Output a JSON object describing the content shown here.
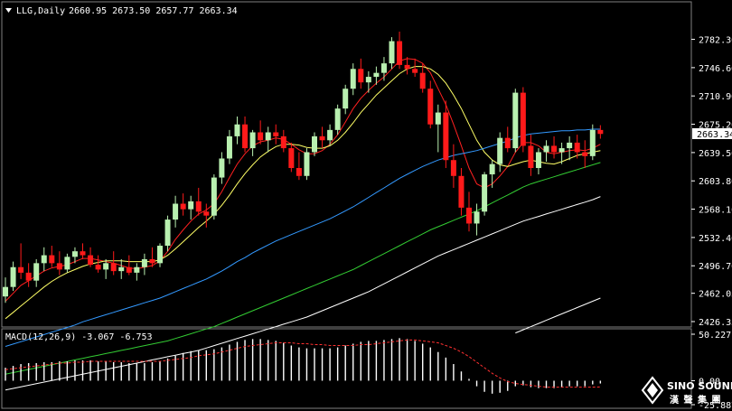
{
  "header": {
    "symbol_label": "LLG,Daily",
    "ohlc": "2660.95 2673.50 2657.77 2663.34"
  },
  "macd_label": "MACD(12,26,9) -3.067 -6.753",
  "watermark": {
    "line1": "SINO SOUND",
    "line2": "漢 聲 集 團"
  },
  "colors": {
    "background": "#000000",
    "bull": "#b9f0b0",
    "bear": "#ff1a1a",
    "ma_fast": "#ff2020",
    "ma_mid": "#ffff66",
    "ma_blue": "#3399ff",
    "ma_green": "#33cc33",
    "ma_white": "#ffffff",
    "macd_hist": "#ffffff",
    "macd_signal": "#ff3030"
  },
  "chart_data": [
    {
      "type": "candlestick",
      "title": "LLG,Daily",
      "ylim": [
        2426.35,
        2800
      ],
      "y_ticks": [
        "2782.30",
        "2746.60",
        "2710.90",
        "2675.20",
        "2639.50",
        "2603.80",
        "2568.10",
        "2532.40",
        "2496.70",
        "2462.05",
        "2426.35"
      ],
      "current_price": "2663.34",
      "candles": [
        [
          2458,
          2482,
          2450,
          2470
        ],
        [
          2470,
          2502,
          2465,
          2495
        ],
        [
          2495,
          2525,
          2480,
          2488
        ],
        [
          2488,
          2500,
          2470,
          2478
        ],
        [
          2478,
          2505,
          2470,
          2500
        ],
        [
          2500,
          2520,
          2490,
          2510
        ],
        [
          2510,
          2522,
          2495,
          2500
        ],
        [
          2500,
          2515,
          2485,
          2492
        ],
        [
          2492,
          2512,
          2488,
          2508
        ],
        [
          2508,
          2520,
          2500,
          2515
        ],
        [
          2515,
          2525,
          2505,
          2510
        ],
        [
          2510,
          2520,
          2495,
          2498
        ],
        [
          2498,
          2510,
          2488,
          2492
        ],
        [
          2492,
          2505,
          2480,
          2500
        ],
        [
          2500,
          2515,
          2485,
          2490
        ],
        [
          2490,
          2505,
          2480,
          2495
        ],
        [
          2495,
          2510,
          2485,
          2488
        ],
        [
          2488,
          2500,
          2478,
          2495
        ],
        [
          2495,
          2512,
          2485,
          2505
        ],
        [
          2505,
          2520,
          2495,
          2500
        ],
        [
          2500,
          2525,
          2495,
          2522
        ],
        [
          2522,
          2560,
          2515,
          2555
        ],
        [
          2555,
          2585,
          2545,
          2575
        ],
        [
          2575,
          2588,
          2560,
          2568
        ],
        [
          2568,
          2585,
          2555,
          2578
        ],
        [
          2578,
          2595,
          2560,
          2565
        ],
        [
          2565,
          2575,
          2545,
          2560
        ],
        [
          2560,
          2612,
          2555,
          2608
        ],
        [
          2608,
          2640,
          2600,
          2632
        ],
        [
          2632,
          2668,
          2625,
          2660
        ],
        [
          2660,
          2685,
          2650,
          2675
        ],
        [
          2675,
          2685,
          2640,
          2645
        ],
        [
          2645,
          2668,
          2635,
          2665
        ],
        [
          2665,
          2680,
          2650,
          2655
        ],
        [
          2655,
          2672,
          2640,
          2665
        ],
        [
          2665,
          2675,
          2650,
          2660
        ],
        [
          2660,
          2668,
          2640,
          2645
        ],
        [
          2645,
          2652,
          2615,
          2620
        ],
        [
          2620,
          2640,
          2605,
          2610
        ],
        [
          2610,
          2645,
          2605,
          2640
        ],
        [
          2640,
          2665,
          2635,
          2660
        ],
        [
          2660,
          2672,
          2645,
          2655
        ],
        [
          2655,
          2675,
          2648,
          2668
        ],
        [
          2668,
          2700,
          2662,
          2695
        ],
        [
          2695,
          2725,
          2688,
          2720
        ],
        [
          2720,
          2752,
          2712,
          2745
        ],
        [
          2745,
          2758,
          2720,
          2728
        ],
        [
          2728,
          2742,
          2715,
          2735
        ],
        [
          2735,
          2748,
          2725,
          2740
        ],
        [
          2740,
          2760,
          2730,
          2752
        ],
        [
          2752,
          2785,
          2745,
          2780
        ],
        [
          2780,
          2792,
          2745,
          2750
        ],
        [
          2750,
          2760,
          2738,
          2745
        ],
        [
          2745,
          2758,
          2735,
          2740
        ],
        [
          2740,
          2752,
          2715,
          2720
        ],
        [
          2720,
          2730,
          2670,
          2675
        ],
        [
          2675,
          2700,
          2640,
          2690
        ],
        [
          2690,
          2705,
          2620,
          2630
        ],
        [
          2630,
          2650,
          2595,
          2610
        ],
        [
          2610,
          2620,
          2560,
          2570
        ],
        [
          2570,
          2590,
          2540,
          2550
        ],
        [
          2550,
          2575,
          2535,
          2565
        ],
        [
          2565,
          2615,
          2560,
          2612
        ],
        [
          2612,
          2630,
          2595,
          2625
        ],
        [
          2625,
          2665,
          2615,
          2658
        ],
        [
          2658,
          2672,
          2640,
          2645
        ],
        [
          2645,
          2720,
          2640,
          2715
        ],
        [
          2715,
          2722,
          2640,
          2648
        ],
        [
          2648,
          2662,
          2610,
          2620
        ],
        [
          2620,
          2645,
          2612,
          2640
        ],
        [
          2640,
          2655,
          2628,
          2648
        ],
        [
          2648,
          2660,
          2632,
          2640
        ],
        [
          2640,
          2652,
          2625,
          2645
        ],
        [
          2645,
          2660,
          2630,
          2652
        ],
        [
          2652,
          2662,
          2632,
          2640
        ],
        [
          2640,
          2655,
          2620,
          2635
        ],
        [
          2635,
          2675,
          2630,
          2668
        ],
        [
          2668,
          2674,
          2657,
          2663
        ]
      ],
      "moving_averages": [
        {
          "key": "ma_fast",
          "values": [
            2452,
            2462,
            2472,
            2478,
            2484,
            2490,
            2494,
            2496,
            2498,
            2502,
            2506,
            2506,
            2504,
            2502,
            2500,
            2497,
            2494,
            2493,
            2495,
            2497,
            2503,
            2515,
            2530,
            2542,
            2553,
            2562,
            2567,
            2575,
            2590,
            2608,
            2625,
            2638,
            2648,
            2653,
            2655,
            2658,
            2656,
            2650,
            2643,
            2638,
            2638,
            2642,
            2650,
            2662,
            2678,
            2695,
            2708,
            2718,
            2727,
            2735,
            2745,
            2755,
            2758,
            2757,
            2752,
            2740,
            2720,
            2700,
            2675,
            2648,
            2620,
            2600,
            2595,
            2600,
            2610,
            2622,
            2640,
            2652,
            2652,
            2648,
            2640,
            2638,
            2640,
            2642,
            2643,
            2642,
            2645,
            2650
          ]
        },
        {
          "key": "ma_mid",
          "values": [
            2430,
            2438,
            2446,
            2454,
            2462,
            2470,
            2477,
            2483,
            2488,
            2492,
            2496,
            2499,
            2501,
            2503,
            2503,
            2503,
            2502,
            2502,
            2502,
            2502,
            2504,
            2510,
            2518,
            2527,
            2536,
            2545,
            2553,
            2562,
            2573,
            2586,
            2600,
            2613,
            2624,
            2634,
            2641,
            2647,
            2650,
            2650,
            2649,
            2646,
            2645,
            2645,
            2648,
            2655,
            2665,
            2677,
            2690,
            2701,
            2712,
            2721,
            2730,
            2739,
            2745,
            2748,
            2748,
            2745,
            2738,
            2727,
            2712,
            2695,
            2675,
            2655,
            2640,
            2630,
            2624,
            2622,
            2625,
            2628,
            2630,
            2628,
            2626,
            2625,
            2628,
            2632,
            2636,
            2638,
            2640,
            2642
          ]
        },
        {
          "key": "ma_blue",
          "values": [
            2395,
            2398,
            2401,
            2404,
            2407,
            2410,
            2413,
            2416,
            2419,
            2422,
            2426,
            2429,
            2432,
            2435,
            2438,
            2441,
            2444,
            2447,
            2450,
            2453,
            2456,
            2460,
            2464,
            2468,
            2472,
            2476,
            2480,
            2485,
            2490,
            2496,
            2502,
            2507,
            2513,
            2518,
            2523,
            2528,
            2532,
            2536,
            2540,
            2544,
            2548,
            2552,
            2556,
            2561,
            2566,
            2571,
            2577,
            2583,
            2589,
            2595,
            2601,
            2607,
            2612,
            2617,
            2622,
            2626,
            2630,
            2633,
            2636,
            2638,
            2640,
            2642,
            2645,
            2648,
            2651,
            2654,
            2658,
            2661,
            2663,
            2664,
            2665,
            2666,
            2667,
            2667,
            2668,
            2668,
            2669,
            2669
          ]
        },
        {
          "key": "ma_green",
          "values": [
            2360,
            2362,
            2364,
            2366,
            2368,
            2370,
            2372,
            2374,
            2376,
            2378,
            2380,
            2382,
            2384,
            2386,
            2388,
            2390,
            2392,
            2394,
            2396,
            2398,
            2400,
            2402,
            2405,
            2408,
            2411,
            2414,
            2417,
            2420,
            2424,
            2428,
            2432,
            2436,
            2440,
            2444,
            2448,
            2452,
            2456,
            2460,
            2464,
            2468,
            2472,
            2476,
            2480,
            2484,
            2488,
            2492,
            2497,
            2502,
            2507,
            2512,
            2517,
            2522,
            2527,
            2532,
            2537,
            2542,
            2546,
            2550,
            2554,
            2558,
            2562,
            2566,
            2571,
            2576,
            2581,
            2586,
            2591,
            2596,
            2600,
            2603,
            2606,
            2609,
            2612,
            2615,
            2618,
            2621,
            2624,
            2627
          ]
        },
        {
          "key": "ma_white",
          "values": [
            2340,
            2342,
            2344,
            2346,
            2348,
            2350,
            2352,
            2354,
            2356,
            2358,
            2360,
            2362,
            2364,
            2366,
            2368,
            2370,
            2372,
            2374,
            2376,
            2378,
            2380,
            2382,
            2384,
            2386,
            2388,
            2390,
            2393,
            2396,
            2399,
            2402,
            2405,
            2408,
            2411,
            2414,
            2417,
            2420,
            2423,
            2426,
            2429,
            2432,
            2436,
            2440,
            2444,
            2448,
            2452,
            2456,
            2460,
            2464,
            2469,
            2474,
            2479,
            2484,
            2489,
            2494,
            2499,
            2504,
            2509,
            2513,
            2517,
            2521,
            2525,
            2529,
            2533,
            2537,
            2541,
            2545,
            2549,
            2553,
            2556,
            2559,
            2562,
            2565,
            2568,
            2571,
            2574,
            2577,
            2580,
            2584
          ]
        },
        {
          "key": "ma_white",
          "values": [
            null,
            null,
            null,
            null,
            null,
            null,
            null,
            null,
            null,
            null,
            null,
            null,
            null,
            null,
            null,
            null,
            null,
            null,
            null,
            null,
            null,
            null,
            null,
            null,
            null,
            null,
            null,
            null,
            null,
            null,
            null,
            null,
            null,
            null,
            null,
            null,
            null,
            null,
            null,
            null,
            null,
            null,
            null,
            null,
            null,
            null,
            null,
            null,
            null,
            null,
            null,
            null,
            null,
            null,
            null,
            null,
            null,
            null,
            null,
            null,
            null,
            null,
            null,
            null,
            null,
            null,
            2412,
            2416,
            2420,
            2424,
            2428,
            2432,
            2436,
            2440,
            2444,
            2448,
            2452,
            2456
          ]
        }
      ]
    },
    {
      "type": "bar",
      "title": "MACD(12,26,9) -3.067 -6.753",
      "ylim": [
        -25.887,
        50.227
      ],
      "y_ticks": [
        "50.227",
        "0.00",
        "-25.887"
      ],
      "histogram": [
        14,
        16,
        18,
        19,
        19,
        20,
        20,
        21,
        21,
        22,
        22,
        22,
        21,
        21,
        20,
        20,
        19,
        19,
        19,
        20,
        21,
        24,
        27,
        30,
        32,
        33,
        33,
        34,
        36,
        39,
        42,
        44,
        45,
        45,
        44,
        43,
        41,
        38,
        36,
        35,
        35,
        35,
        35,
        36,
        38,
        40,
        42,
        43,
        43,
        44,
        45,
        46,
        45,
        43,
        40,
        36,
        31,
        25,
        18,
        10,
        2,
        -6,
        -12,
        -14,
        -13,
        -11,
        -6,
        -5,
        -7,
        -8,
        -8,
        -8,
        -7,
        -6,
        -6,
        -6,
        -4,
        -3
      ],
      "signal": [
        12,
        13,
        14,
        15,
        16,
        17,
        18,
        19,
        19,
        20,
        20,
        21,
        21,
        21,
        21,
        21,
        21,
        21,
        21,
        21,
        21,
        22,
        23,
        24,
        25,
        27,
        28,
        29,
        31,
        33,
        35,
        37,
        38,
        39,
        40,
        41,
        41,
        41,
        40,
        40,
        39,
        39,
        38,
        38,
        38,
        38,
        39,
        39,
        40,
        41,
        42,
        43,
        44,
        44,
        43,
        42,
        41,
        38,
        35,
        31,
        26,
        20,
        14,
        8,
        3,
        -1,
        -3,
        -4,
        -5,
        -6,
        -7,
        -7,
        -7,
        -7,
        -7,
        -7,
        -7,
        -6.753
      ]
    }
  ]
}
